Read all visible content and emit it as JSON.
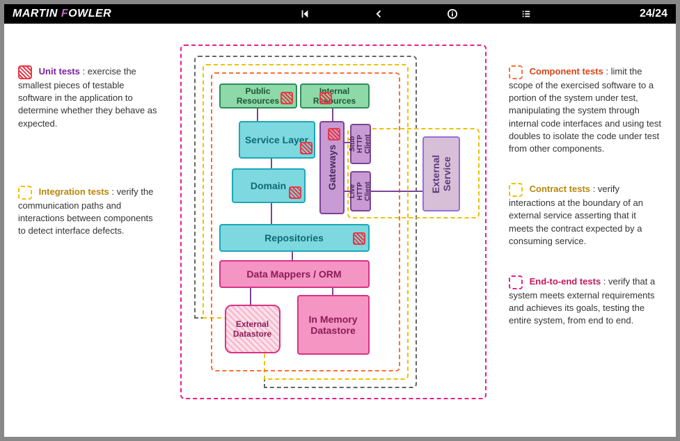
{
  "header": {
    "brand_first": "MARTIN ",
    "brand_accent": "F",
    "brand_rest": "OWLER",
    "page_counter": "24/24"
  },
  "legend": {
    "unit": {
      "title": "Unit tests",
      "desc": " : exercise the smallest pieces of testable software in the application to determine whether they behave as expected."
    },
    "integration": {
      "title": "Integration tests",
      "desc": " : verify the communication paths and interactions between components to detect interface defects."
    },
    "component": {
      "title": "Component tests",
      "desc": " : limit the scope of the exercised software to a portion of the system under test, manipulating the system through internal code interfaces and using test doubles to isolate the code under test from other components."
    },
    "contract": {
      "title": "Contract tests",
      "desc": " : verify interactions at the boundary of an external service asserting that it meets the contract expected by a consuming service."
    },
    "e2e": {
      "title": "End-to-end tests",
      "desc": " : verify that a system meets external requirements and achieves its goals, testing the entire system, from end to end."
    }
  },
  "diagram": {
    "public_resources": "Public Resources",
    "internal_resources": "Internal Resources",
    "service_layer": "Service Layer",
    "domain": "Domain",
    "gateways": "Gateways",
    "stub_http": "Stub HTTP Client",
    "live_http": "Live HTTP Client",
    "external_service": "External Service",
    "repositories": "Repositories",
    "orm": "Data Mappers / ORM",
    "external_ds": "External Datastore",
    "inmem_ds": "In Memory Datastore"
  }
}
